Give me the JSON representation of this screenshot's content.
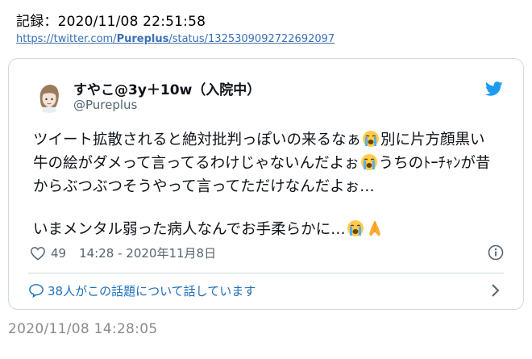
{
  "record": {
    "text": "記録：2020/11/08 22:51:58"
  },
  "source": {
    "prefix": "https://twitter.com/",
    "user": "Pureplus",
    "suffix": "/status/1325309092722692097"
  },
  "tweet": {
    "display_name": "すやこ@3y＋10w（入院中）",
    "handle": "@Pureplus",
    "lines": [
      {
        "segments": [
          "ツイート拡散されると絶対批判っぽいの来るなぁ",
          "別に片方顔黒い"
        ],
        "emoji": [
          "crying-face"
        ]
      },
      {
        "segments": [
          "牛の絵がダメって言ってるわけじゃないんだよぉ",
          "うちのﾄｰﾁｬﾝが昔"
        ],
        "emoji": [
          "crying-face"
        ]
      },
      {
        "segments": [
          "からぶつぶつそうやって言ってただけなんだよぉ…"
        ]
      },
      {
        "segments": [
          "いまメンタル弱った病人なんでお手柔らかに…"
        ],
        "emoji": [
          "crying-face",
          "folded-hands"
        ]
      }
    ],
    "like_count": "49",
    "timestamp": "14:28 - 2020年11月8日"
  },
  "reply_prompt": "38人がこの話題について話しています",
  "captured_at": "2020/11/08 14:28:05",
  "colors": {
    "link": "#3b6fb6",
    "twitter_blue": "#1d9bf0",
    "border": "#cfd9de",
    "muted": "#536471"
  }
}
